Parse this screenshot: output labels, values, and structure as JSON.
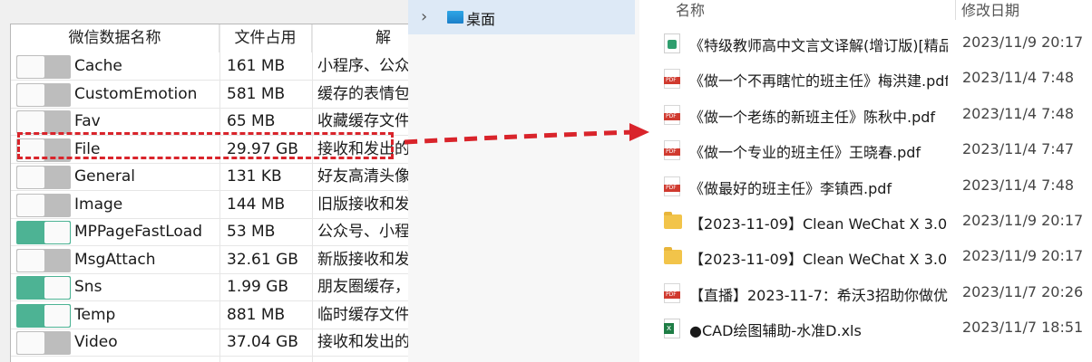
{
  "left_table": {
    "headers": [
      "微信数据名称",
      "文件占用",
      "解"
    ],
    "rows": [
      {
        "toggle": "off",
        "name": "Cache",
        "size": "161 MB",
        "desc": "小程序、公众"
      },
      {
        "toggle": "off",
        "name": "CustomEmotion",
        "size": "581 MB",
        "desc": "缓存的表情包"
      },
      {
        "toggle": "off",
        "name": "Fav",
        "size": "65 MB",
        "desc": "收藏缓存文件"
      },
      {
        "toggle": "off",
        "name": "File",
        "size": "29.97 GB",
        "desc": "接收和发出的"
      },
      {
        "toggle": "off",
        "name": "General",
        "size": "131 KB",
        "desc": "好友高清头像"
      },
      {
        "toggle": "off",
        "name": "Image",
        "size": "144 MB",
        "desc": "旧版接收和发"
      },
      {
        "toggle": "on",
        "name": "MPPageFastLoad",
        "size": "53 MB",
        "desc": "公众号、小程"
      },
      {
        "toggle": "off",
        "name": "MsgAttach",
        "size": "32.61 GB",
        "desc": "新版接收和发"
      },
      {
        "toggle": "on",
        "name": "Sns",
        "size": "1.99 GB",
        "desc": "朋友圈缓存，"
      },
      {
        "toggle": "on",
        "name": "Temp",
        "size": "881 MB",
        "desc": "临时缓存文件"
      },
      {
        "toggle": "off",
        "name": "Video",
        "size": "37.04 GB",
        "desc": "接收和发出的"
      }
    ]
  },
  "tree": {
    "expand_icon": "chevron-right-icon",
    "desktop_label": "桌面"
  },
  "file_list": {
    "header_name": "名称",
    "header_date": "修改日期",
    "files": [
      {
        "type": "epub",
        "name": "《特级教师高中文言文译解(增订版)[精品...",
        "date": "2023/11/9 20:17"
      },
      {
        "type": "pdf",
        "name": "《做一个不再瞎忙的班主任》梅洪建.pdf",
        "date": "2023/11/4 7:48"
      },
      {
        "type": "pdf",
        "name": "《做一个老练的新班主任》陈秋中.pdf",
        "date": "2023/11/4 7:48"
      },
      {
        "type": "pdf",
        "name": "《做一个专业的班主任》王晓春.pdf",
        "date": "2023/11/4 7:47"
      },
      {
        "type": "pdf",
        "name": "《做最好的班主任》李镇西.pdf",
        "date": "2023/11/4 7:48"
      },
      {
        "type": "folder",
        "name": "【2023-11-09】Clean WeChat X 3.0（...",
        "date": "2023/11/9 20:17"
      },
      {
        "type": "folder",
        "name": "【2023-11-09】Clean WeChat X 3.0（...",
        "date": "2023/11/9 20:17"
      },
      {
        "type": "pdf",
        "name": "【直播】2023-11-7：希沃3招助你做优...",
        "date": "2023/11/7 20:26"
      },
      {
        "type": "xls",
        "name": "●CAD绘图辅助-水准D.xls",
        "date": "2023/11/7 18:51"
      }
    ]
  },
  "colors": {
    "highlight_red": "#d9242b",
    "toggle_on": "#4db394",
    "toggle_off": "#bdbdbd",
    "tree_selected": "#dde9f6"
  }
}
